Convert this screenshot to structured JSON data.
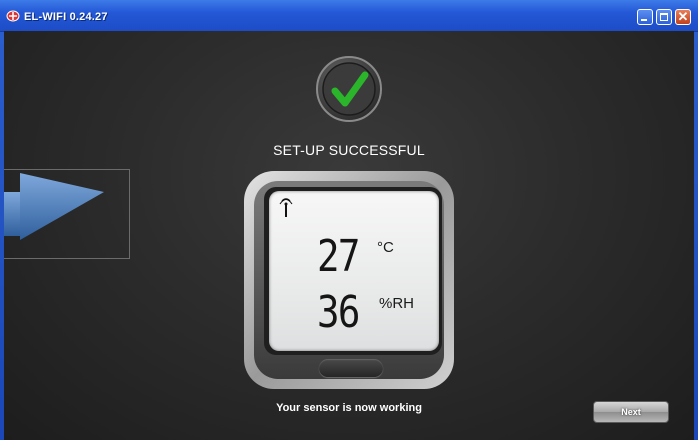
{
  "window": {
    "title": "EL-WIFI 0.24.27",
    "icons": [
      "app-logo-icon",
      "minimize-icon",
      "maximize-icon",
      "close-icon"
    ]
  },
  "wizard": {
    "status_title": "SET-UP SUCCESSFUL",
    "status_icon": "checkmark-icon",
    "status_message": "Your sensor is now working",
    "next_label": "Next"
  },
  "device_display": {
    "signal_icon": "wireless-signal-icon",
    "temperature": "27",
    "temperature_unit": "°C",
    "humidity": "36",
    "humidity_unit": "%RH"
  },
  "colors": {
    "titlebar": "#2458d6",
    "background": "#2c2c2c",
    "check_green": "#2bb52b",
    "arrow_blue": "#4a7ec2"
  }
}
